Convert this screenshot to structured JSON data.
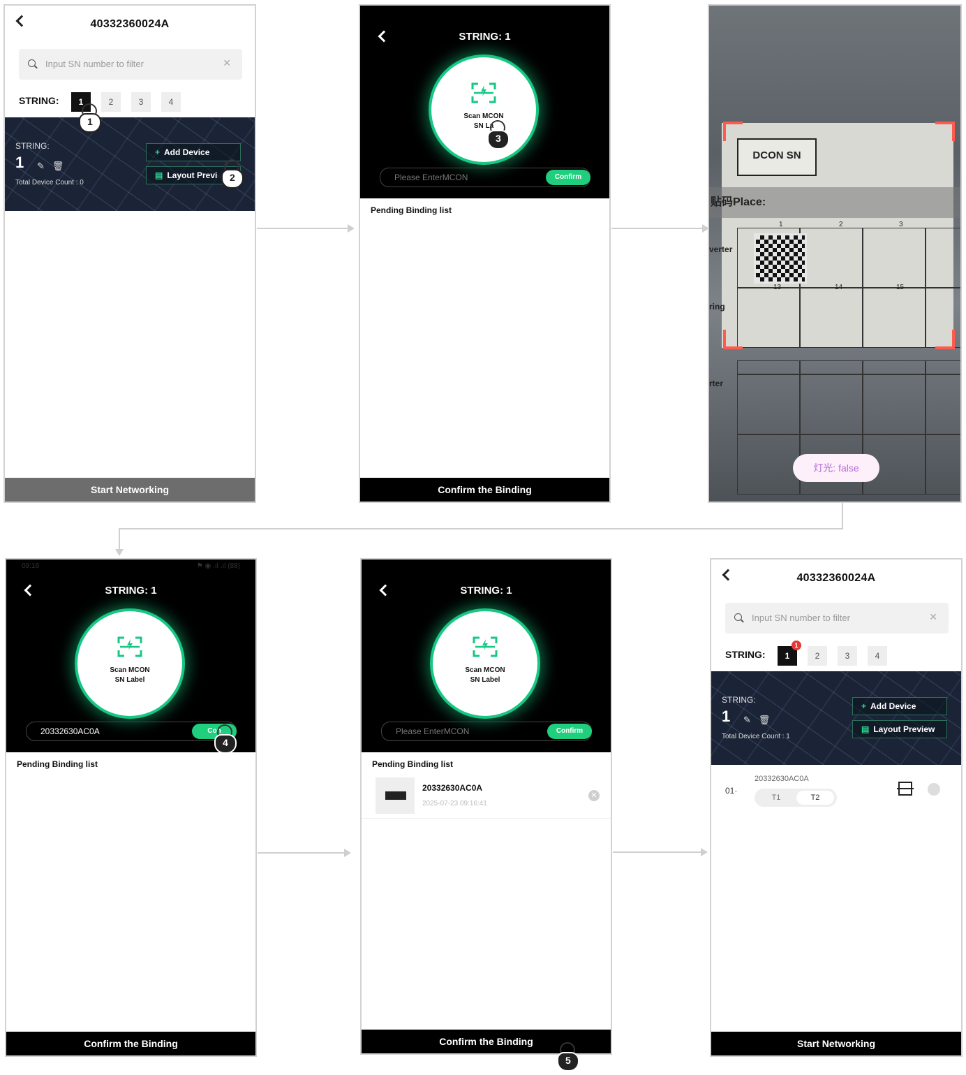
{
  "device_list": {
    "title": "40332360024A",
    "search_placeholder": "Input SN number to filter",
    "string_label": "STRING:",
    "strings": [
      "1",
      "2",
      "3",
      "4"
    ],
    "banner": {
      "string_caption": "STRING:",
      "string_number": "1",
      "count_before": "Total Device Count : 0",
      "count_after": "Total Device Count : 1"
    },
    "add_device": "Add Device",
    "layout_preview": "Layout Preview",
    "layout_preview_cut": "Layout Previ",
    "start_networking": "Start Networking",
    "badge": "1"
  },
  "scan": {
    "status_time": "09:16",
    "status_right": "⚑ ◉ .ıl .ıl (88)",
    "title": "STRING: 1",
    "scan_text_1": "Scan MCON",
    "scan_text_2": "SN Label",
    "scan_text_2_cut": "SN La",
    "input_placeholder": "Please EnterMCON",
    "input_value": "20332630AC0A",
    "confirm": "Confirm",
    "confirm_cut": "Con",
    "pending_title": "Pending Binding list",
    "pending_item": {
      "sn": "20332630AC0A",
      "time": "2025-07-23 09:16:41"
    },
    "confirm_binding": "Confirm the Binding"
  },
  "camera": {
    "label": "DCON SN",
    "place": "贴码Place:",
    "torch": "灯光: false",
    "col_nums": [
      "1",
      "2",
      "3"
    ],
    "col_nums_b": [
      "13",
      "14",
      "15"
    ],
    "row_fragments": [
      "verter",
      "ring",
      "rter"
    ]
  },
  "device_entry": {
    "index": "01·",
    "sn": "20332630AC0A",
    "t1": "T1",
    "t2": "T2"
  },
  "steps": [
    "1",
    "2",
    "3",
    "4",
    "5"
  ],
  "colors": {
    "accent": "#1fcf7e",
    "bar_grey": "#6d6d6d",
    "bar_black": "#000000",
    "badge": "#e53935"
  }
}
